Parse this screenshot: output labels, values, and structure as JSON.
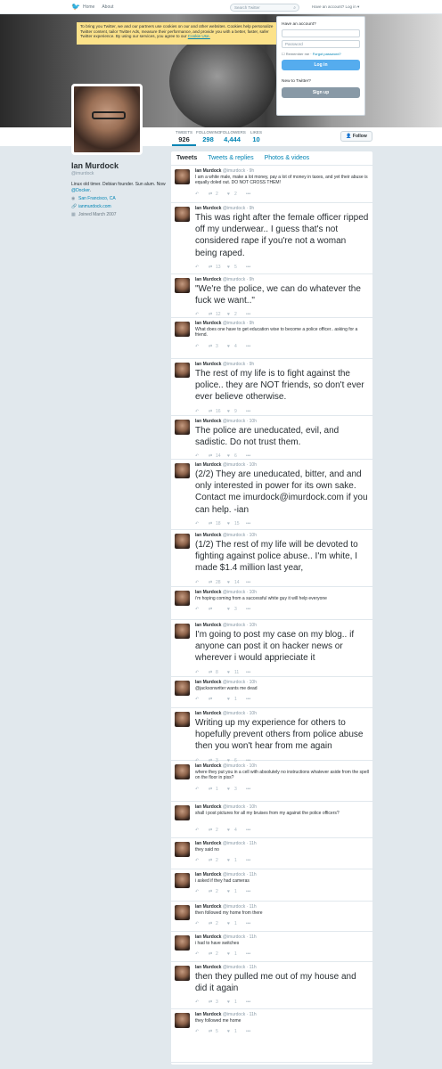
{
  "topbar": {
    "home": "Home",
    "about": "About",
    "search_placeholder": "Search Twitter",
    "login_prompt": "Have an account? Log in ▾"
  },
  "cookie_notice": {
    "text": "To bring you Twitter, we and our partners use cookies on our and other websites. Cookies help personalize Twitter content, tailor Twitter Ads, measure their performance, and provide you with a better, faster, safer Twitter experience. By using our services, you agree to our",
    "link": "Cookie Use."
  },
  "login": {
    "title": "Have an account?",
    "username_placeholder": "",
    "password_placeholder": "Password",
    "remember": "Remember me",
    "forgot": "Forgot password?",
    "login_button": "Log in",
    "new_title": "New to Twitter?",
    "signup_button": "Sign up"
  },
  "profile": {
    "name": "Ian Murdock",
    "handle": "@imurdock",
    "bio_start": "Linux old timer. Debian founder. Sun alum. Now ",
    "bio_link": "@Docker",
    "bio_end": ".",
    "location": "San Francisco, CA",
    "website": "ianmurdock.com",
    "joined": "Joined March 2007",
    "follow_button": "Follow",
    "stats": [
      {
        "label": "TWEETS",
        "value": "926"
      },
      {
        "label": "FOLLOWING",
        "value": "298"
      },
      {
        "label": "FOLLOWERS",
        "value": "4,444"
      },
      {
        "label": "LIKES",
        "value": "10"
      }
    ]
  },
  "tabs": [
    "Tweets",
    "Tweets & replies",
    "Photos & videos"
  ],
  "tweets": [
    {
      "name": "Ian Murdock",
      "handle": "@imurdock",
      "time": "9h",
      "size": "sm",
      "text": "I am a white male, make a lot money, pay a lot of money in taxes, and yet their abuse is equally doled out. DO NOT CROSS THEM!",
      "rt": "2",
      "like": "2"
    },
    {
      "name": "Ian Murdock",
      "handle": "@imurdock",
      "time": "9h",
      "size": "lg",
      "text": "This was right after the female officer ripped off my underwear.. I guess that's not considered rape if you're not a woman being raped.",
      "rt": "13",
      "like": "5"
    },
    {
      "name": "Ian Murdock",
      "handle": "@imurdock",
      "time": "9h",
      "size": "lg",
      "text": "\"We're the police, we can do whatever the fuck we want..\"",
      "rt": "12",
      "like": "2"
    },
    {
      "name": "Ian Murdock",
      "handle": "@imurdock",
      "time": "9h",
      "size": "sm",
      "text": "What does one have to get education wise to become a police officer.. asking for a friend.",
      "rt": "3",
      "like": "4"
    },
    {
      "name": "Ian Murdock",
      "handle": "@imurdock",
      "time": "9h",
      "size": "lg",
      "text": "The rest of my life is to fight against the police.. they are NOT friends, so don't ever ever believe otherwise.",
      "rt": "16",
      "like": "9"
    },
    {
      "name": "Ian Murdock",
      "handle": "@imurdock",
      "time": "10h",
      "size": "lg",
      "text": "The police are uneducated, evil, and sadistic. Do not trust them.",
      "rt": "14",
      "like": "6"
    },
    {
      "name": "Ian Murdock",
      "handle": "@imurdock",
      "time": "10h",
      "size": "lg",
      "text": "(2/2) They are uneducated, bitter, and and only interested in power for its own sake. Contact me imurdock@imurdock.com if you can help. -ian",
      "rt": "18",
      "like": "15"
    },
    {
      "name": "Ian Murdock",
      "handle": "@imurdock",
      "time": "10h",
      "size": "lg",
      "text": "(1/2) The rest of my life will be devoted to fighting against police abuse.. I'm white, I made $1.4 million last year,",
      "rt": "28",
      "like": "14"
    },
    {
      "name": "Ian Murdock",
      "handle": "@imurdock",
      "time": "10h",
      "size": "sm",
      "text": "i'm hoping coming from a successful white guy it will help everyone",
      "rt": "",
      "like": "3"
    },
    {
      "name": "Ian Murdock",
      "handle": "@imurdock",
      "time": "10h",
      "size": "lg",
      "text": "I'm going to post my case on my blog.. if anyone can post it on hacker news or wherever i would apprieciate it",
      "rt": "8",
      "like": "11"
    },
    {
      "name": "Ian Murdock",
      "handle": "@imurdock",
      "time": "10h",
      "size": "sm",
      "text": "@jacksonwriter wants me dead",
      "rt": "",
      "like": "1"
    },
    {
      "name": "Ian Murdock",
      "handle": "@imurdock",
      "time": "10h",
      "size": "lg",
      "text": "Writing up my experience for others to hopefully prevent others from police abuse then you won't hear from me again",
      "rt": "3",
      "like": "6"
    },
    {
      "name": "Ian Murdock",
      "handle": "@imurdock",
      "time": "10h",
      "size": "sm",
      "text": "where they put you in a cell with absolutely no instructions whatever aside from the spell on the floor in piss?",
      "rt": "1",
      "like": "3"
    },
    {
      "name": "Ian Murdock",
      "handle": "@imurdock",
      "time": "10h",
      "size": "sm",
      "text": "shall i post pictures for all my bruises from my against the police officers?",
      "rt": "2",
      "like": "4"
    },
    {
      "name": "Ian Murdock",
      "handle": "@imurdock",
      "time": "11h",
      "size": "sm",
      "text": "they said no",
      "rt": "2",
      "like": "1"
    },
    {
      "name": "Ian Murdock",
      "handle": "@imurdock",
      "time": "11h",
      "size": "sm",
      "text": "i asked if they had cameras",
      "rt": "2",
      "like": "1"
    },
    {
      "name": "Ian Murdock",
      "handle": "@imurdock",
      "time": "11h",
      "size": "sm",
      "text": "then followed my home from there",
      "rt": "2",
      "like": "1"
    },
    {
      "name": "Ian Murdock",
      "handle": "@imurdock",
      "time": "11h",
      "size": "sm",
      "text": "i had to have switches",
      "rt": "2",
      "like": "1"
    },
    {
      "name": "Ian Murdock",
      "handle": "@imurdock",
      "time": "11h",
      "size": "lg",
      "text": "then they pulled me out of my house and did it again",
      "rt": "3",
      "like": "1"
    },
    {
      "name": "Ian Murdock",
      "handle": "@imurdock",
      "time": "11h",
      "size": "sm",
      "text": "they followed me home",
      "rt": "5",
      "like": "1"
    }
  ],
  "icons": {
    "reply": "reply-icon",
    "retweet": "retweet-icon",
    "like": "heart-icon",
    "more": "more-icon"
  }
}
